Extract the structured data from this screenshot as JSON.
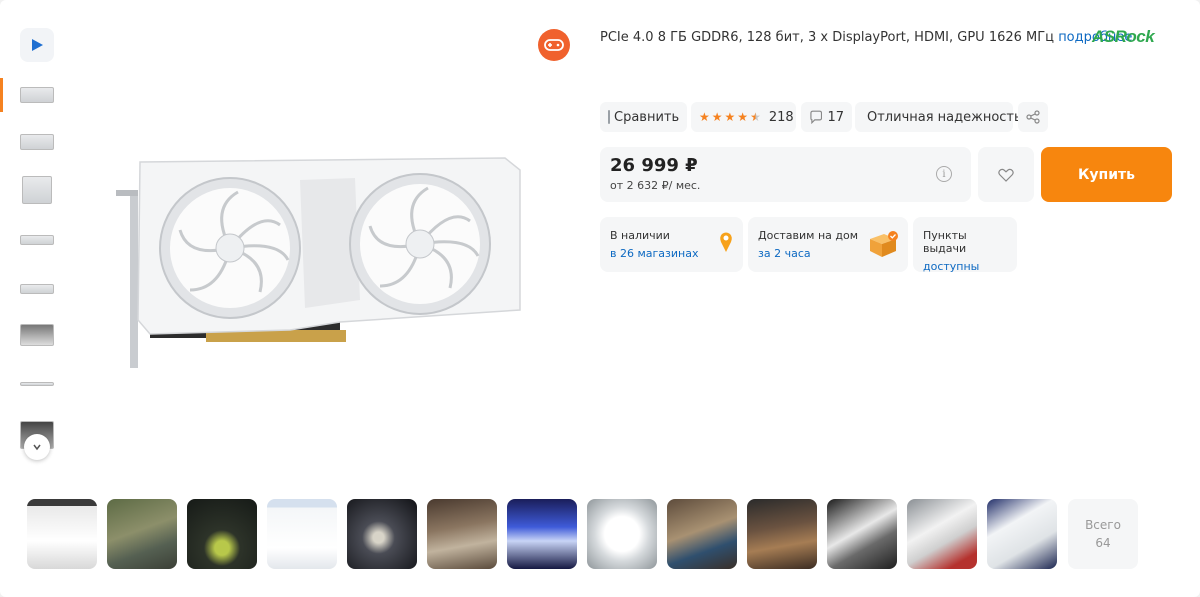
{
  "thumbnails": {
    "video_icon": "play-icon",
    "count_visible": 8,
    "active_index": 0,
    "scroll_icon": "chevron-down-icon"
  },
  "product": {
    "specs": "PCIe 4.0 8 ГБ GDDR6, 128 бит, 3 x DisplayPort, HDMI, GPU 1626 МГц",
    "specs_link": "подробнее",
    "brand": "ASRock",
    "vendor_icon": "gamepad-icon"
  },
  "actions": {
    "compare": "Сравнить",
    "rating_value": 4.5,
    "reviews_count": "218",
    "questions_count": "17",
    "reliability": "Отличная надежность",
    "share_icon": "share-icon"
  },
  "price": {
    "amount": "26 999 ₽",
    "credit": "от 2 632 ₽/ мес.",
    "info_icon": "info-icon",
    "wishlist_icon": "heart-icon",
    "buy_label": "Купить"
  },
  "delivery": [
    {
      "title": "В наличии",
      "detail": "в 26 магазинах",
      "icon": "map-pin-icon"
    },
    {
      "title": "Доставим на дом",
      "detail": "за 2 часа",
      "icon": "box-icon"
    },
    {
      "title": "Пункты выдачи",
      "detail": "доступны",
      "icon": ""
    }
  ],
  "review_photos": {
    "total_label": "Всего",
    "total_count": "64"
  },
  "colors": {
    "accent": "#f7860e",
    "link": "#0d69c2",
    "brand": "#2fa84f"
  }
}
